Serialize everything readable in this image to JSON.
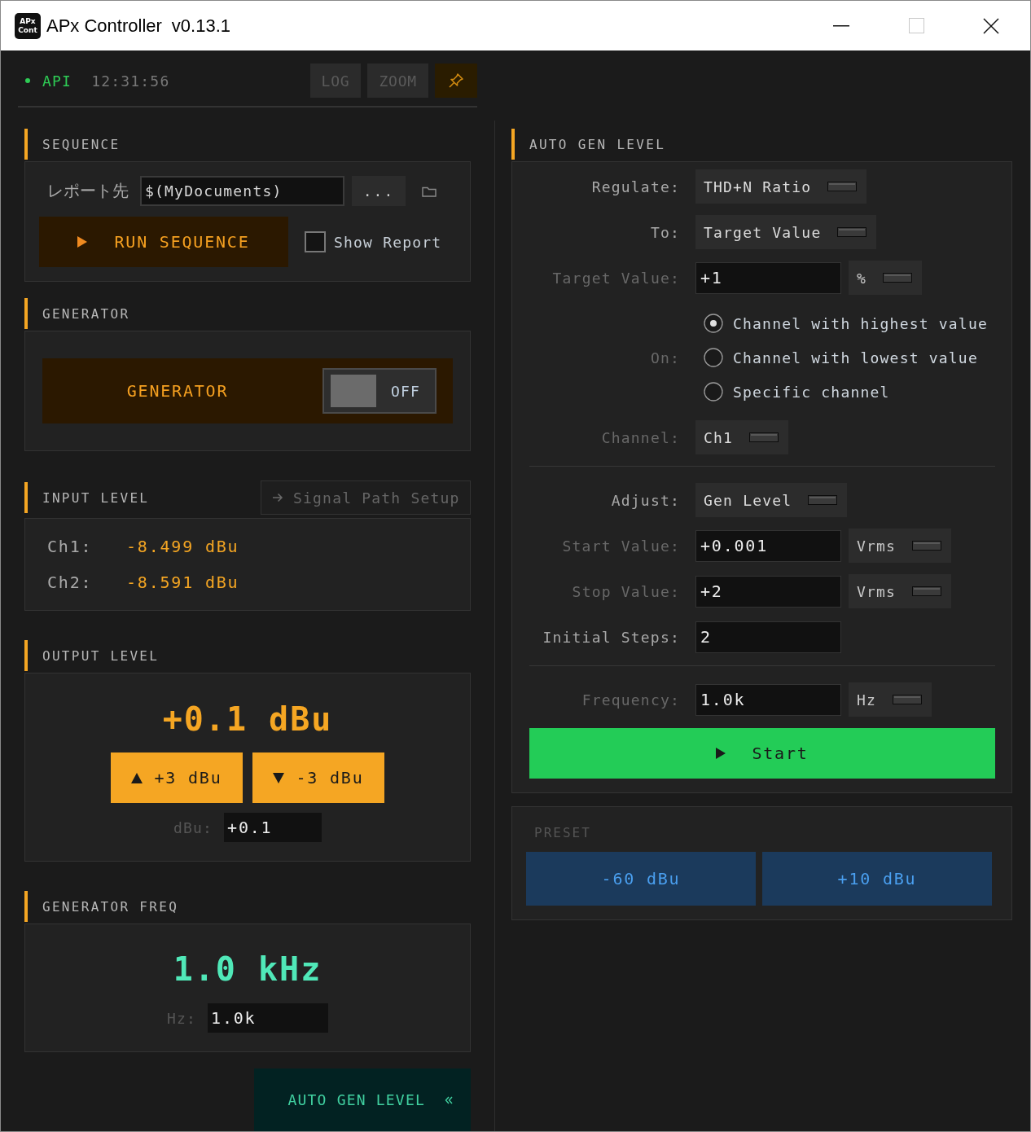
{
  "window": {
    "logo": [
      "APx",
      "Cont"
    ],
    "title": "APx Controller",
    "version": "v0.13.1"
  },
  "toolbar": {
    "status": {
      "label": "API",
      "connected": true
    },
    "time": "12:31:56",
    "buttons": [
      {
        "kind": "text",
        "label": "LOG"
      },
      {
        "kind": "text",
        "label": "ZOOM"
      },
      {
        "kind": "pin"
      }
    ]
  },
  "sequence": {
    "title": "SEQUENCE",
    "report_label": "レポート先",
    "report_path": "$(MyDocuments)",
    "browse_button": "...",
    "run_button": "RUN SEQUENCE",
    "show_report": {
      "label": "Show Report",
      "checked": false
    }
  },
  "generator": {
    "title": "GENERATOR",
    "label": "GENERATOR",
    "toggle": {
      "on": false,
      "label": "OFF"
    }
  },
  "input_level": {
    "title": "INPUT LEVEL",
    "link": "Signal Path Setup",
    "channels": [
      {
        "name": "Ch1:",
        "value": "-8.499 dBu"
      },
      {
        "name": "Ch2:",
        "value": "-8.591 dBu"
      }
    ]
  },
  "output_level": {
    "title": "OUTPUT LEVEL",
    "value": "+0.1 dBu",
    "buttons": [
      {
        "kind": "up",
        "label": "+3 dBu"
      },
      {
        "kind": "down",
        "label": "-3 dBu"
      }
    ],
    "field_label": "dBu:",
    "field_value": "+0.1"
  },
  "generator_freq": {
    "title": "GENERATOR FREQ",
    "value": "1.0 kHz",
    "field_label": "Hz:",
    "field_value": "1.0k"
  },
  "auto_gen_button": {
    "label": "AUTO GEN LEVEL"
  },
  "auto_gen_level": {
    "title": "AUTO GEN LEVEL",
    "rows": [
      {
        "kind": "dropdown",
        "label": "Regulate:",
        "value": "THD+N Ratio",
        "dimmed": false
      },
      {
        "kind": "dropdown",
        "label": "To:",
        "value": "Target Value",
        "dimmed": false
      },
      {
        "kind": "input",
        "label": "Target Value:",
        "value": "+1",
        "unit": "%",
        "dimmed": true
      },
      {
        "kind": "radio",
        "label": "On:",
        "dimmed": true,
        "options": [
          {
            "label": "Channel with highest value",
            "selected": true
          },
          {
            "label": "Channel with lowest value",
            "selected": false
          },
          {
            "label": "Specific channel",
            "selected": false
          }
        ]
      },
      {
        "kind": "dropdown",
        "label": "Channel:",
        "value": "Ch1",
        "dimmed": true
      },
      {
        "kind": "divider"
      },
      {
        "kind": "dropdown",
        "label": "Adjust:",
        "value": "Gen Level",
        "dimmed": false
      },
      {
        "kind": "input",
        "label": "Start Value:",
        "value": "+0.001",
        "unit": "Vrms",
        "dimmed": true
      },
      {
        "kind": "input",
        "label": "Stop Value:",
        "value": "+2",
        "unit": "Vrms",
        "dimmed": true
      },
      {
        "kind": "input",
        "label": "Initial Steps:",
        "value": "2",
        "dimmed": false
      },
      {
        "kind": "divider"
      },
      {
        "kind": "input",
        "label": "Frequency:",
        "value": "1.0k",
        "unit": "Hz",
        "dimmed": true
      }
    ],
    "start_button": "Start"
  },
  "preset": {
    "title": "PRESET",
    "buttons": [
      "-60 dBu",
      "+10 dBu"
    ]
  }
}
